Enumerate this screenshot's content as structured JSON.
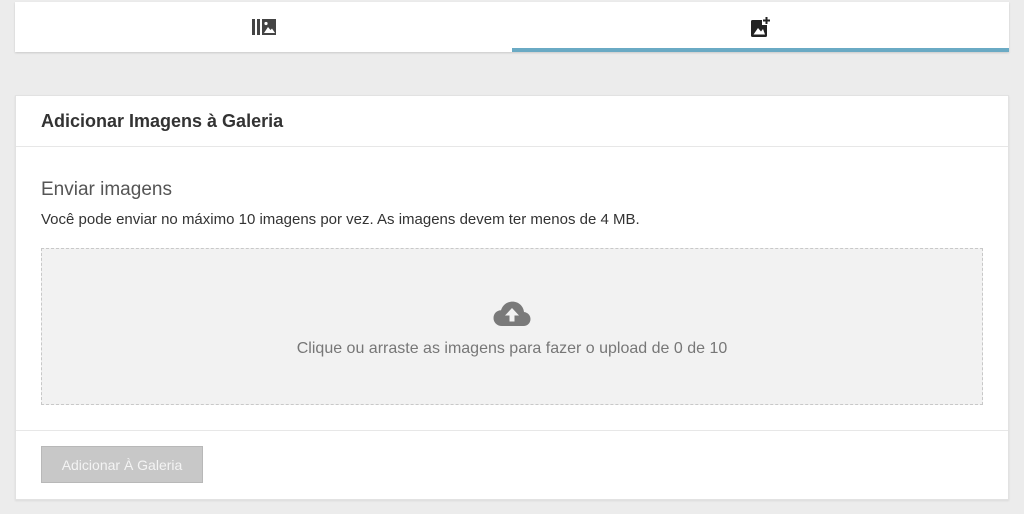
{
  "tabs": [
    {
      "icon": "photo-library-icon",
      "active": false
    },
    {
      "icon": "add-photo-icon",
      "active": true
    }
  ],
  "colors": {
    "tab_indicator": "#6aaac4",
    "icon": "#444444",
    "upload_icon": "#7a7a7a",
    "dropzone_bg": "#f2f2f2",
    "button_disabled_bg": "#c8c8c8"
  },
  "card": {
    "title": "Adicionar Imagens à Galeria",
    "section_title": "Enviar imagens",
    "section_help": "Você pode enviar no máximo 10 imagens por vez. As imagens devem ter menos de 4 MB.",
    "dropzone": {
      "icon": "cloud-upload-icon",
      "text": "Clique ou arraste as imagens para fazer o upload de 0 de 10"
    },
    "submit_label": "Adicionar À Galeria"
  }
}
